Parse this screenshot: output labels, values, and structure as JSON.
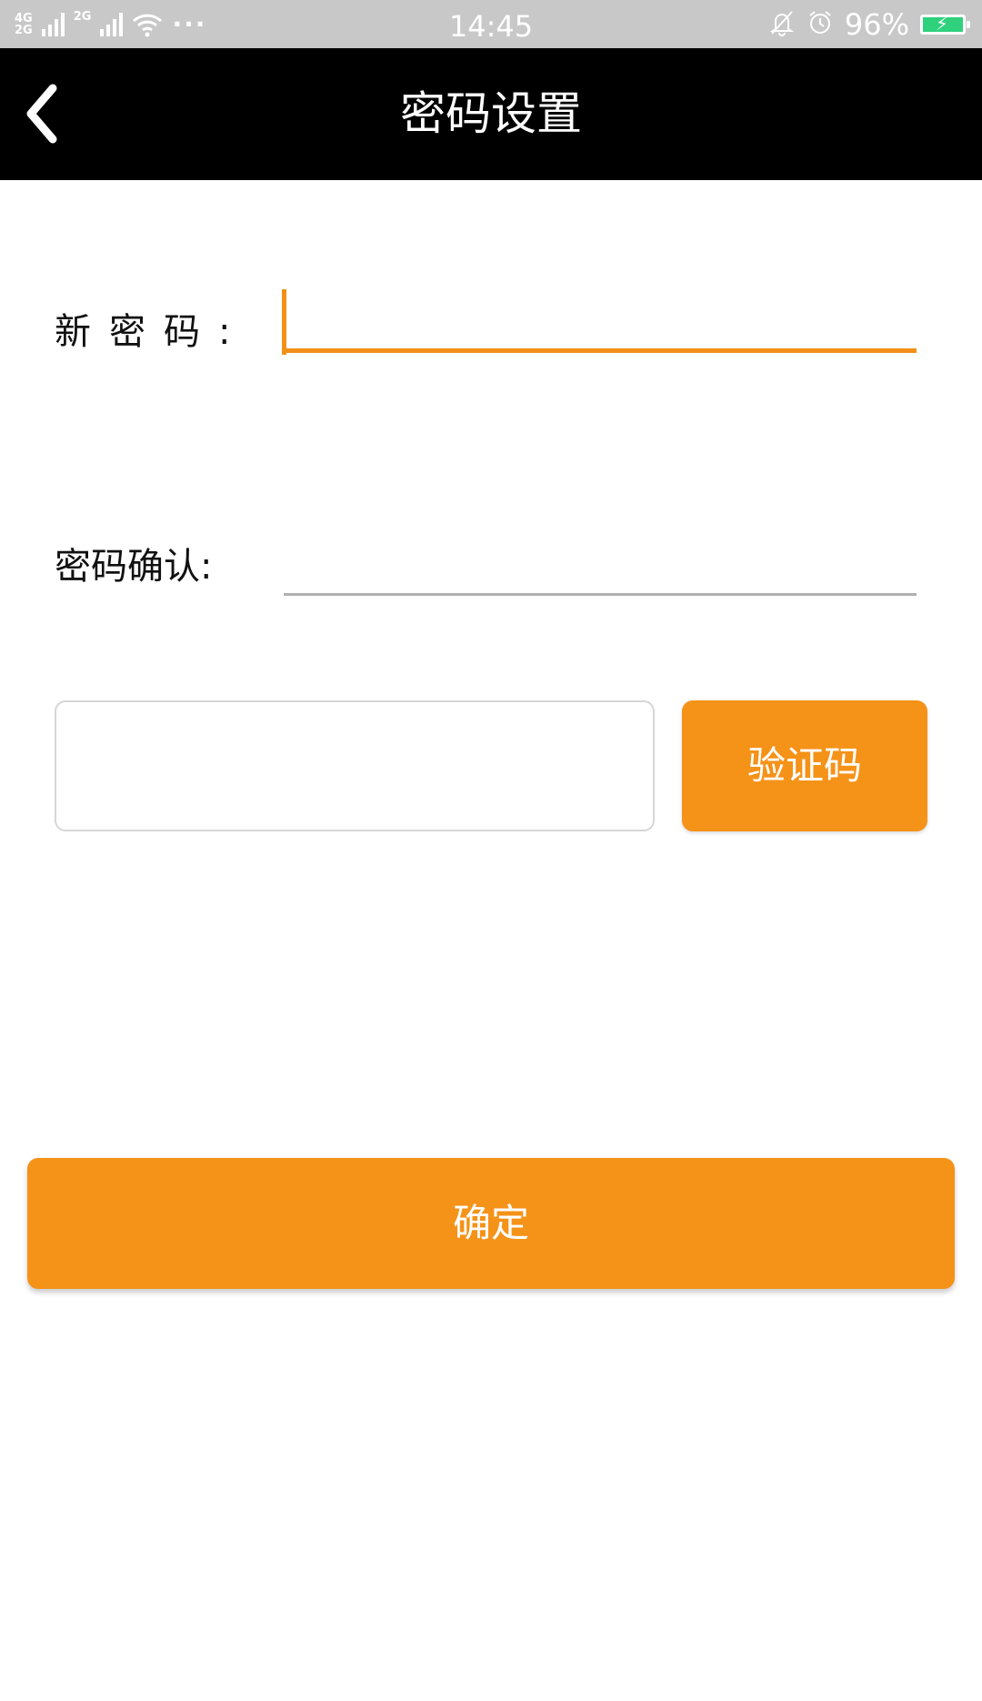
{
  "status_bar": {
    "network_top": "4G",
    "network_bottom": "2G",
    "network_2": "2G",
    "more": "···",
    "time": "14:45",
    "battery_percent": "96%",
    "icons": [
      "mute-bell-icon",
      "alarm-icon",
      "battery-charging-icon"
    ],
    "battery_color": "#2fd17d"
  },
  "header": {
    "back_icon": "chevron-left-icon",
    "title": "密码设置"
  },
  "form": {
    "new_password_label": "新密码:",
    "new_password_value": "",
    "confirm_password_label": "密码确认:",
    "confirm_password_value": "",
    "code_value": "",
    "code_button_label": "验证码",
    "submit_label": "确定"
  },
  "colors": {
    "accent": "#f59218",
    "header_bg": "#000000",
    "status_bar_bg": "#c8c8c8"
  }
}
